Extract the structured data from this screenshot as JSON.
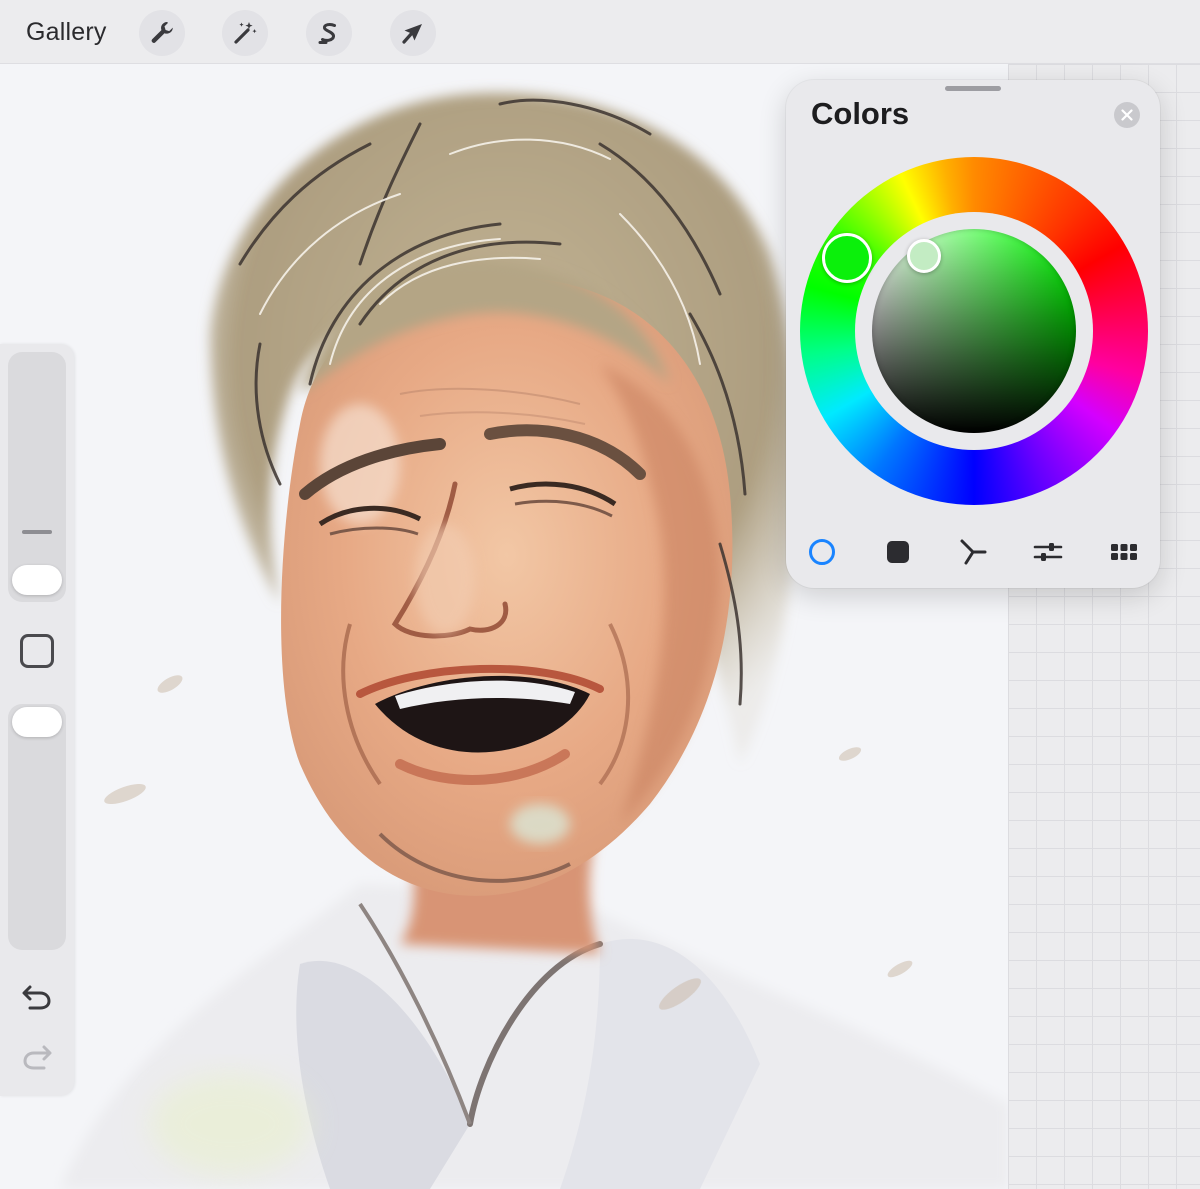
{
  "toolbar": {
    "gallery_label": "Gallery",
    "tools": [
      {
        "name": "actions",
        "icon": "wrench-icon"
      },
      {
        "name": "adjustments",
        "icon": "magic-wand-icon"
      },
      {
        "name": "selection",
        "icon": "selection-s-icon"
      },
      {
        "name": "transform",
        "icon": "arrow-cursor-icon"
      }
    ]
  },
  "colors_panel": {
    "title": "Colors",
    "selected_hue_color": "#0bf00b",
    "selected_color": "#c3ecc3",
    "active_mode": "disc",
    "accent_color": "#1a84ff",
    "modes": [
      {
        "name": "disc",
        "icon": "color-disc-icon"
      },
      {
        "name": "classic",
        "icon": "square-swatch-icon"
      },
      {
        "name": "harmony",
        "icon": "harmony-icon"
      },
      {
        "name": "value",
        "icon": "sliders-icon"
      },
      {
        "name": "palettes",
        "icon": "grid-palette-icon"
      }
    ]
  },
  "sidebar": {
    "tools": [
      "brush-size-slider",
      "modify-button",
      "opacity-slider",
      "undo-icon",
      "redo-icon"
    ]
  }
}
